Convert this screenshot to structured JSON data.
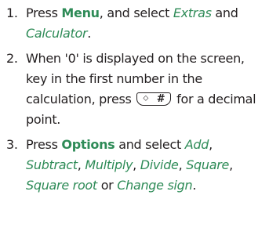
{
  "steps": [
    {
      "number": "1.",
      "parts": {
        "t1": "Press ",
        "k1": "Menu",
        "t2": ", and select ",
        "o1": "Extras",
        "t3": " and ",
        "o2": "Calculator",
        "t4": "."
      }
    },
    {
      "number": "2.",
      "parts": {
        "t1": "When '0' is displayed on the screen, key in the first number in the calculation, press ",
        "key_symbol": "⬦",
        "key_main": "#",
        "t2": " for a decimal point."
      }
    },
    {
      "number": "3.",
      "parts": {
        "t1": "Press ",
        "k1": "Options",
        "t2": " and select ",
        "o1": "Add",
        "s1": ", ",
        "o2": "Subtract",
        "s2": ", ",
        "o3": "Multiply",
        "s3": ", ",
        "o4": "Divide",
        "s4": ", ",
        "o5": "Square",
        "s5": ", ",
        "o6": "Square root",
        "t3": " or ",
        "o7": "Change sign",
        "t4": "."
      }
    }
  ],
  "colors": {
    "text": "#231f20",
    "accent": "#2e8b57"
  }
}
